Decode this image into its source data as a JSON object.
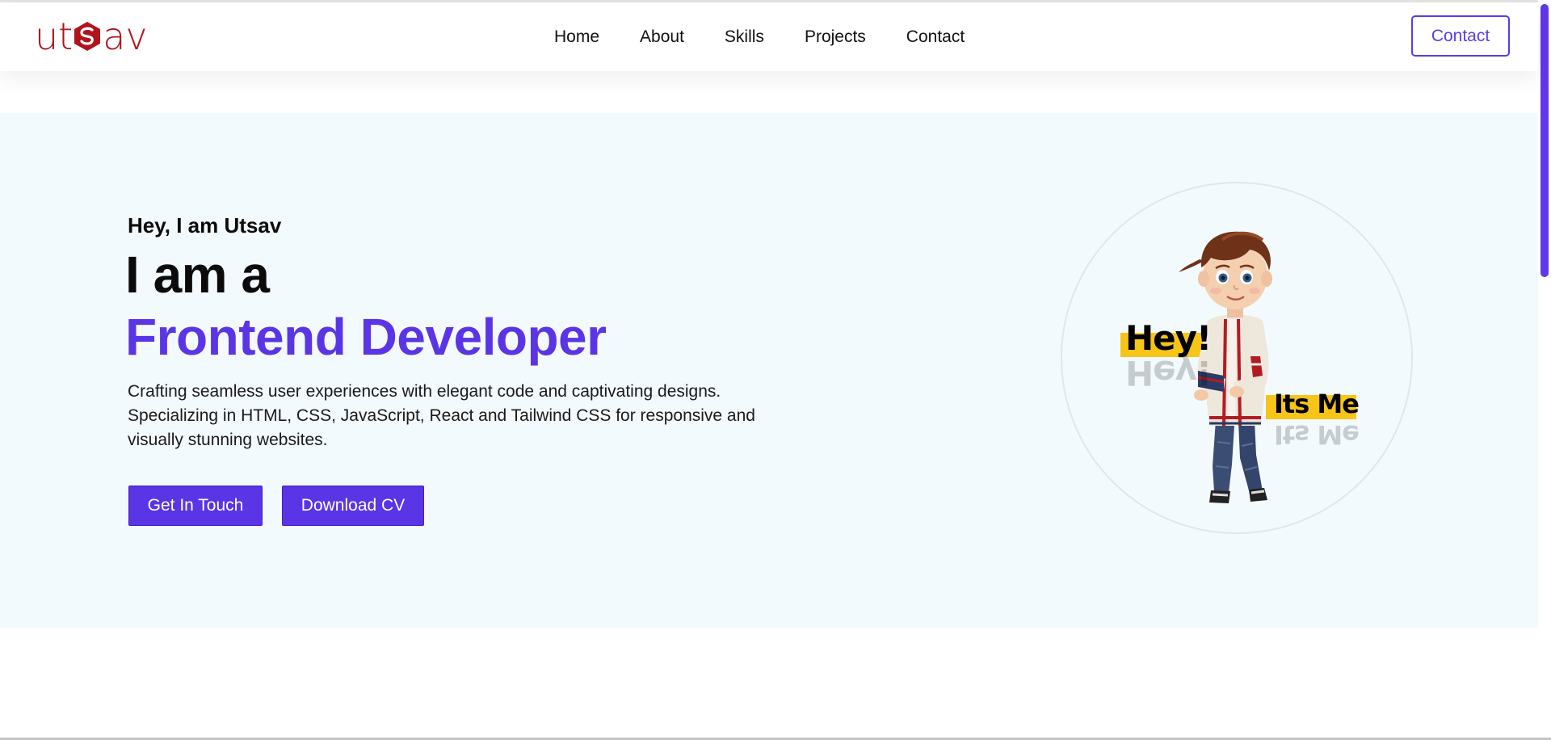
{
  "brand": {
    "logo_text": "utsav",
    "logo_color": "#b0141c"
  },
  "nav": {
    "links": [
      {
        "label": "Home"
      },
      {
        "label": "About"
      },
      {
        "label": "Skills"
      },
      {
        "label": "Projects"
      },
      {
        "label": "Contact"
      }
    ],
    "cta_label": "Contact"
  },
  "hero": {
    "greeting": "Hey, I am Utsav",
    "headline": "I am a",
    "role": "Frontend Developer",
    "description": "Crafting seamless user experiences with elegant code and captivating designs. Specializing in HTML, CSS, JavaScript, React and Tailwind CSS for responsive and visually stunning websites.",
    "buttons": {
      "get_in_touch": "Get In Touch",
      "download_cv": "Download CV"
    },
    "avatar": {
      "caption_1": "Hey!",
      "caption_2": "Its Me"
    }
  },
  "colors": {
    "accent": "#5a35e6",
    "hero_background": "#f3fafd",
    "caption_highlight": "#f7c418",
    "scrollbar": "#6236ea"
  },
  "icons": [
    "logo-mark-icon"
  ]
}
